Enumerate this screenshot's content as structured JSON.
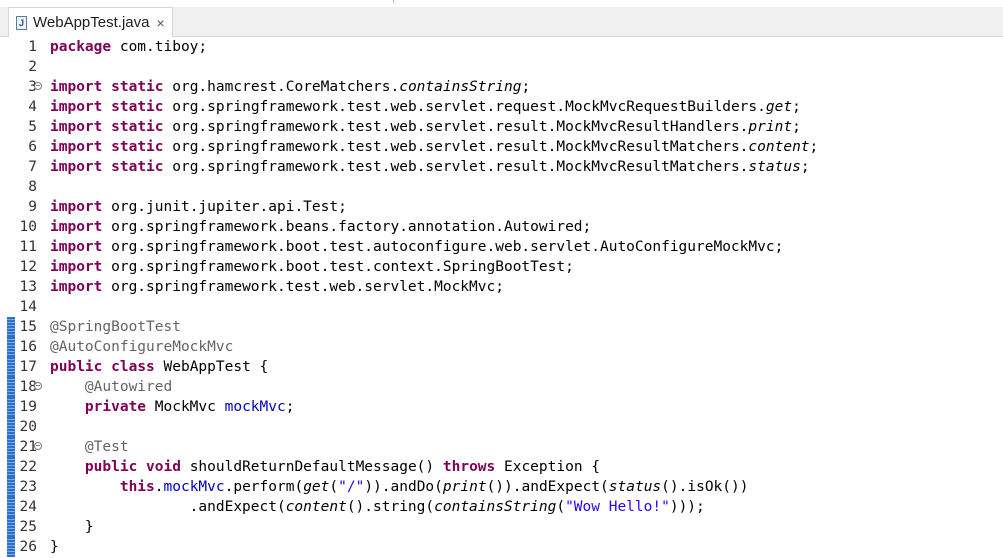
{
  "tab": {
    "title": "WebAppTest.java",
    "icon": "java-file-icon",
    "close": "×"
  },
  "lines": {
    "l1": {
      "n": "1",
      "t": [
        {
          "text": "package",
          "cls": "kw"
        },
        {
          "text": " com.tiboy;"
        }
      ]
    },
    "l2": {
      "n": "2",
      "t": []
    },
    "l3": {
      "n": "3",
      "t": [
        {
          "text": "import",
          "cls": "kw"
        },
        {
          "text": " "
        },
        {
          "text": "static",
          "cls": "kw"
        },
        {
          "text": " org.hamcrest.CoreMatchers."
        },
        {
          "text": "containsString",
          "cls": "it"
        },
        {
          "text": ";"
        }
      ]
    },
    "l4": {
      "n": "4",
      "t": [
        {
          "text": "import",
          "cls": "kw"
        },
        {
          "text": " "
        },
        {
          "text": "static",
          "cls": "kw"
        },
        {
          "text": " org.springframework.test.web.servlet.request.MockMvcRequestBuilders."
        },
        {
          "text": "get",
          "cls": "it"
        },
        {
          "text": ";"
        }
      ]
    },
    "l5": {
      "n": "5",
      "t": [
        {
          "text": "import",
          "cls": "kw"
        },
        {
          "text": " "
        },
        {
          "text": "static",
          "cls": "kw"
        },
        {
          "text": " org.springframework.test.web.servlet.result.MockMvcResultHandlers."
        },
        {
          "text": "print",
          "cls": "it"
        },
        {
          "text": ";"
        }
      ]
    },
    "l6": {
      "n": "6",
      "t": [
        {
          "text": "import",
          "cls": "kw"
        },
        {
          "text": " "
        },
        {
          "text": "static",
          "cls": "kw"
        },
        {
          "text": " org.springframework.test.web.servlet.result.MockMvcResultMatchers."
        },
        {
          "text": "content",
          "cls": "it"
        },
        {
          "text": ";"
        }
      ]
    },
    "l7": {
      "n": "7",
      "t": [
        {
          "text": "import",
          "cls": "kw"
        },
        {
          "text": " "
        },
        {
          "text": "static",
          "cls": "kw"
        },
        {
          "text": " org.springframework.test.web.servlet.result.MockMvcResultMatchers."
        },
        {
          "text": "status",
          "cls": "it"
        },
        {
          "text": ";"
        }
      ]
    },
    "l8": {
      "n": "8",
      "t": []
    },
    "l9": {
      "n": "9",
      "t": [
        {
          "text": "import",
          "cls": "kw"
        },
        {
          "text": " org.junit.jupiter.api.Test;"
        }
      ]
    },
    "l10": {
      "n": "10",
      "t": [
        {
          "text": "import",
          "cls": "kw"
        },
        {
          "text": " org.springframework.beans.factory.annotation.Autowired;"
        }
      ]
    },
    "l11": {
      "n": "11",
      "t": [
        {
          "text": "import",
          "cls": "kw"
        },
        {
          "text": " org.springframework.boot.test.autoconfigure.web.servlet.AutoConfigureMockMvc;"
        }
      ]
    },
    "l12": {
      "n": "12",
      "t": [
        {
          "text": "import",
          "cls": "kw"
        },
        {
          "text": " org.springframework.boot.test.context.SpringBootTest;"
        }
      ]
    },
    "l13": {
      "n": "13",
      "t": [
        {
          "text": "import",
          "cls": "kw"
        },
        {
          "text": " org.springframework.test.web.servlet.MockMvc;"
        }
      ]
    },
    "l14": {
      "n": "14",
      "t": []
    },
    "l15": {
      "n": "15",
      "t": [
        {
          "text": "@SpringBootTest",
          "cls": "ann"
        }
      ]
    },
    "l16": {
      "n": "16",
      "t": [
        {
          "text": "@AutoConfigureMockMvc",
          "cls": "ann"
        }
      ]
    },
    "l17": {
      "n": "17",
      "t": [
        {
          "text": "public",
          "cls": "kw"
        },
        {
          "text": " "
        },
        {
          "text": "class",
          "cls": "kw"
        },
        {
          "text": " WebAppTest {"
        }
      ]
    },
    "l18": {
      "n": "18",
      "t": [
        {
          "text": "    "
        },
        {
          "text": "@Autowired",
          "cls": "ann"
        }
      ]
    },
    "l19": {
      "n": "19",
      "t": [
        {
          "text": "    "
        },
        {
          "text": "private",
          "cls": "kw"
        },
        {
          "text": " MockMvc "
        },
        {
          "text": "mockMvc",
          "cls": "fld"
        },
        {
          "text": ";"
        }
      ]
    },
    "l20": {
      "n": "20",
      "t": []
    },
    "l21": {
      "n": "21",
      "t": [
        {
          "text": "    "
        },
        {
          "text": "@Test",
          "cls": "ann"
        }
      ]
    },
    "l22": {
      "n": "22",
      "t": [
        {
          "text": "    "
        },
        {
          "text": "public",
          "cls": "kw"
        },
        {
          "text": " "
        },
        {
          "text": "void",
          "cls": "kw"
        },
        {
          "text": " shouldReturnDefaultMessage() "
        },
        {
          "text": "throws",
          "cls": "kw"
        },
        {
          "text": " Exception {"
        }
      ]
    },
    "l23": {
      "n": "23",
      "t": [
        {
          "text": "        "
        },
        {
          "text": "this",
          "cls": "kw"
        },
        {
          "text": "."
        },
        {
          "text": "mockMvc",
          "cls": "fld"
        },
        {
          "text": ".perform("
        },
        {
          "text": "get",
          "cls": "it"
        },
        {
          "text": "("
        },
        {
          "text": "\"/\"",
          "cls": "str"
        },
        {
          "text": ")).andDo("
        },
        {
          "text": "print",
          "cls": "it"
        },
        {
          "text": "()).andExpect("
        },
        {
          "text": "status",
          "cls": "it"
        },
        {
          "text": "().isOk())"
        }
      ]
    },
    "l24": {
      "n": "24",
      "t": [
        {
          "text": "                .andExpect("
        },
        {
          "text": "content",
          "cls": "it"
        },
        {
          "text": "().string("
        },
        {
          "text": "containsString",
          "cls": "it"
        },
        {
          "text": "("
        },
        {
          "text": "\"Wow Hello!\"",
          "cls": "str"
        },
        {
          "text": ")));"
        }
      ]
    },
    "l25": {
      "n": "25",
      "t": [
        {
          "text": "    }"
        }
      ]
    },
    "l26": {
      "n": "26",
      "t": [
        {
          "text": "}"
        }
      ]
    }
  },
  "fold_glyph": "⊖"
}
